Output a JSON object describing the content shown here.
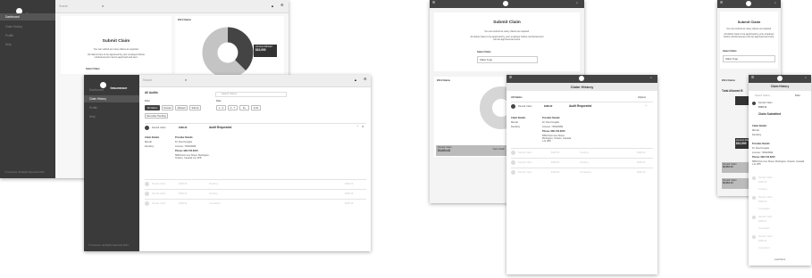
{
  "brand": {
    "name": "Insurance",
    "copyright": "© Insurance. All Rights Reserved 2014"
  },
  "search": {
    "placeholder": "Search"
  },
  "sidebar": {
    "items": [
      {
        "label": "Dashboard"
      },
      {
        "label": "Claim History"
      },
      {
        "label": "Profile"
      },
      {
        "label": "Help"
      }
    ]
  },
  "submit_claim": {
    "title": "Submit Claim",
    "line1": "You can submit as many claims as required.",
    "line2": "All claims have to be approved by your employer before reimbursement can be approved and sent.",
    "select_label": "Select Claim",
    "select_value": "Claim Type"
  },
  "claims_panel": {
    "year_label": "2014 Claims",
    "approved_label": "Amount Allowed",
    "approved_value": "$10,000",
    "total_label": "Total Allowed B"
  },
  "history": {
    "title": "Claim History",
    "all_audits": "All Audits",
    "all_claims": "All Claims",
    "options": "Options",
    "search_placeholder": "Search Claims",
    "filter_label": "Filter",
    "date_label": "Date",
    "filters": [
      "All Claims",
      "Denied",
      "Allowed",
      "Submit",
      "Reminder Pending"
    ],
    "dates": [
      "1 - 3",
      "4 - 7",
      "8+",
      "9-10"
    ],
    "active_claim": {
      "name": "Denied Claim",
      "amount": "$468.32",
      "status": "Audit Requested",
      "amount_alt": "$368.32",
      "status_alt": "Claim Submitted"
    },
    "details_label": "Claim Details",
    "provider_label": "Provider Details",
    "detail_rows": [
      "Mental",
      "Dentistry"
    ],
    "provider": {
      "name": "Dr. Doe Douglas",
      "license": "License: 736326994",
      "phone": "Phone: 983-745-6215",
      "address": "5849 Dormuns Street, Burlington, Ontario, Canada L1L 3P8"
    },
    "rows": [
      {
        "name": "Denied Claim",
        "amount": "$468.32",
        "status": "Pending",
        "amount_alt": "$398.29"
      },
      {
        "name": "Denied Claim",
        "amount": "$468.32",
        "status": "Pending",
        "amount_alt": "$398.29"
      },
      {
        "name": "Denied Claim",
        "amount": "$108.94",
        "status": "Completed",
        "amount_alt": "$358.29"
      }
    ],
    "mobile_rows": [
      {
        "name": "Denied Claim",
        "amount": "$368.32",
        "status": "Pending"
      },
      {
        "name": "Denied Claim",
        "amount": "$368.32",
        "status": "Completed"
      },
      {
        "name": "Denied Claim",
        "amount": "$368.32",
        "status": "Completed"
      },
      {
        "name": "Denied Claim",
        "amount": "$368.32",
        "status": "Completed"
      }
    ],
    "load_more": "Load More"
  },
  "status_cards": [
    {
      "name": "Denied Claim",
      "amount": "$3,684.43",
      "action": "View Graph"
    },
    {
      "name": "Denied Claim",
      "amount": "$3,684.43"
    },
    {
      "name": "Denied Claim",
      "amount": "$3,684.43"
    }
  ],
  "colors": {
    "sidebar": "#3a3a3a",
    "topbar": "#eeeeee",
    "dark": "#444444"
  },
  "chart_data": {
    "type": "pie",
    "labels": [
      "Used",
      "Remaining"
    ],
    "values": [
      40,
      60
    ]
  }
}
